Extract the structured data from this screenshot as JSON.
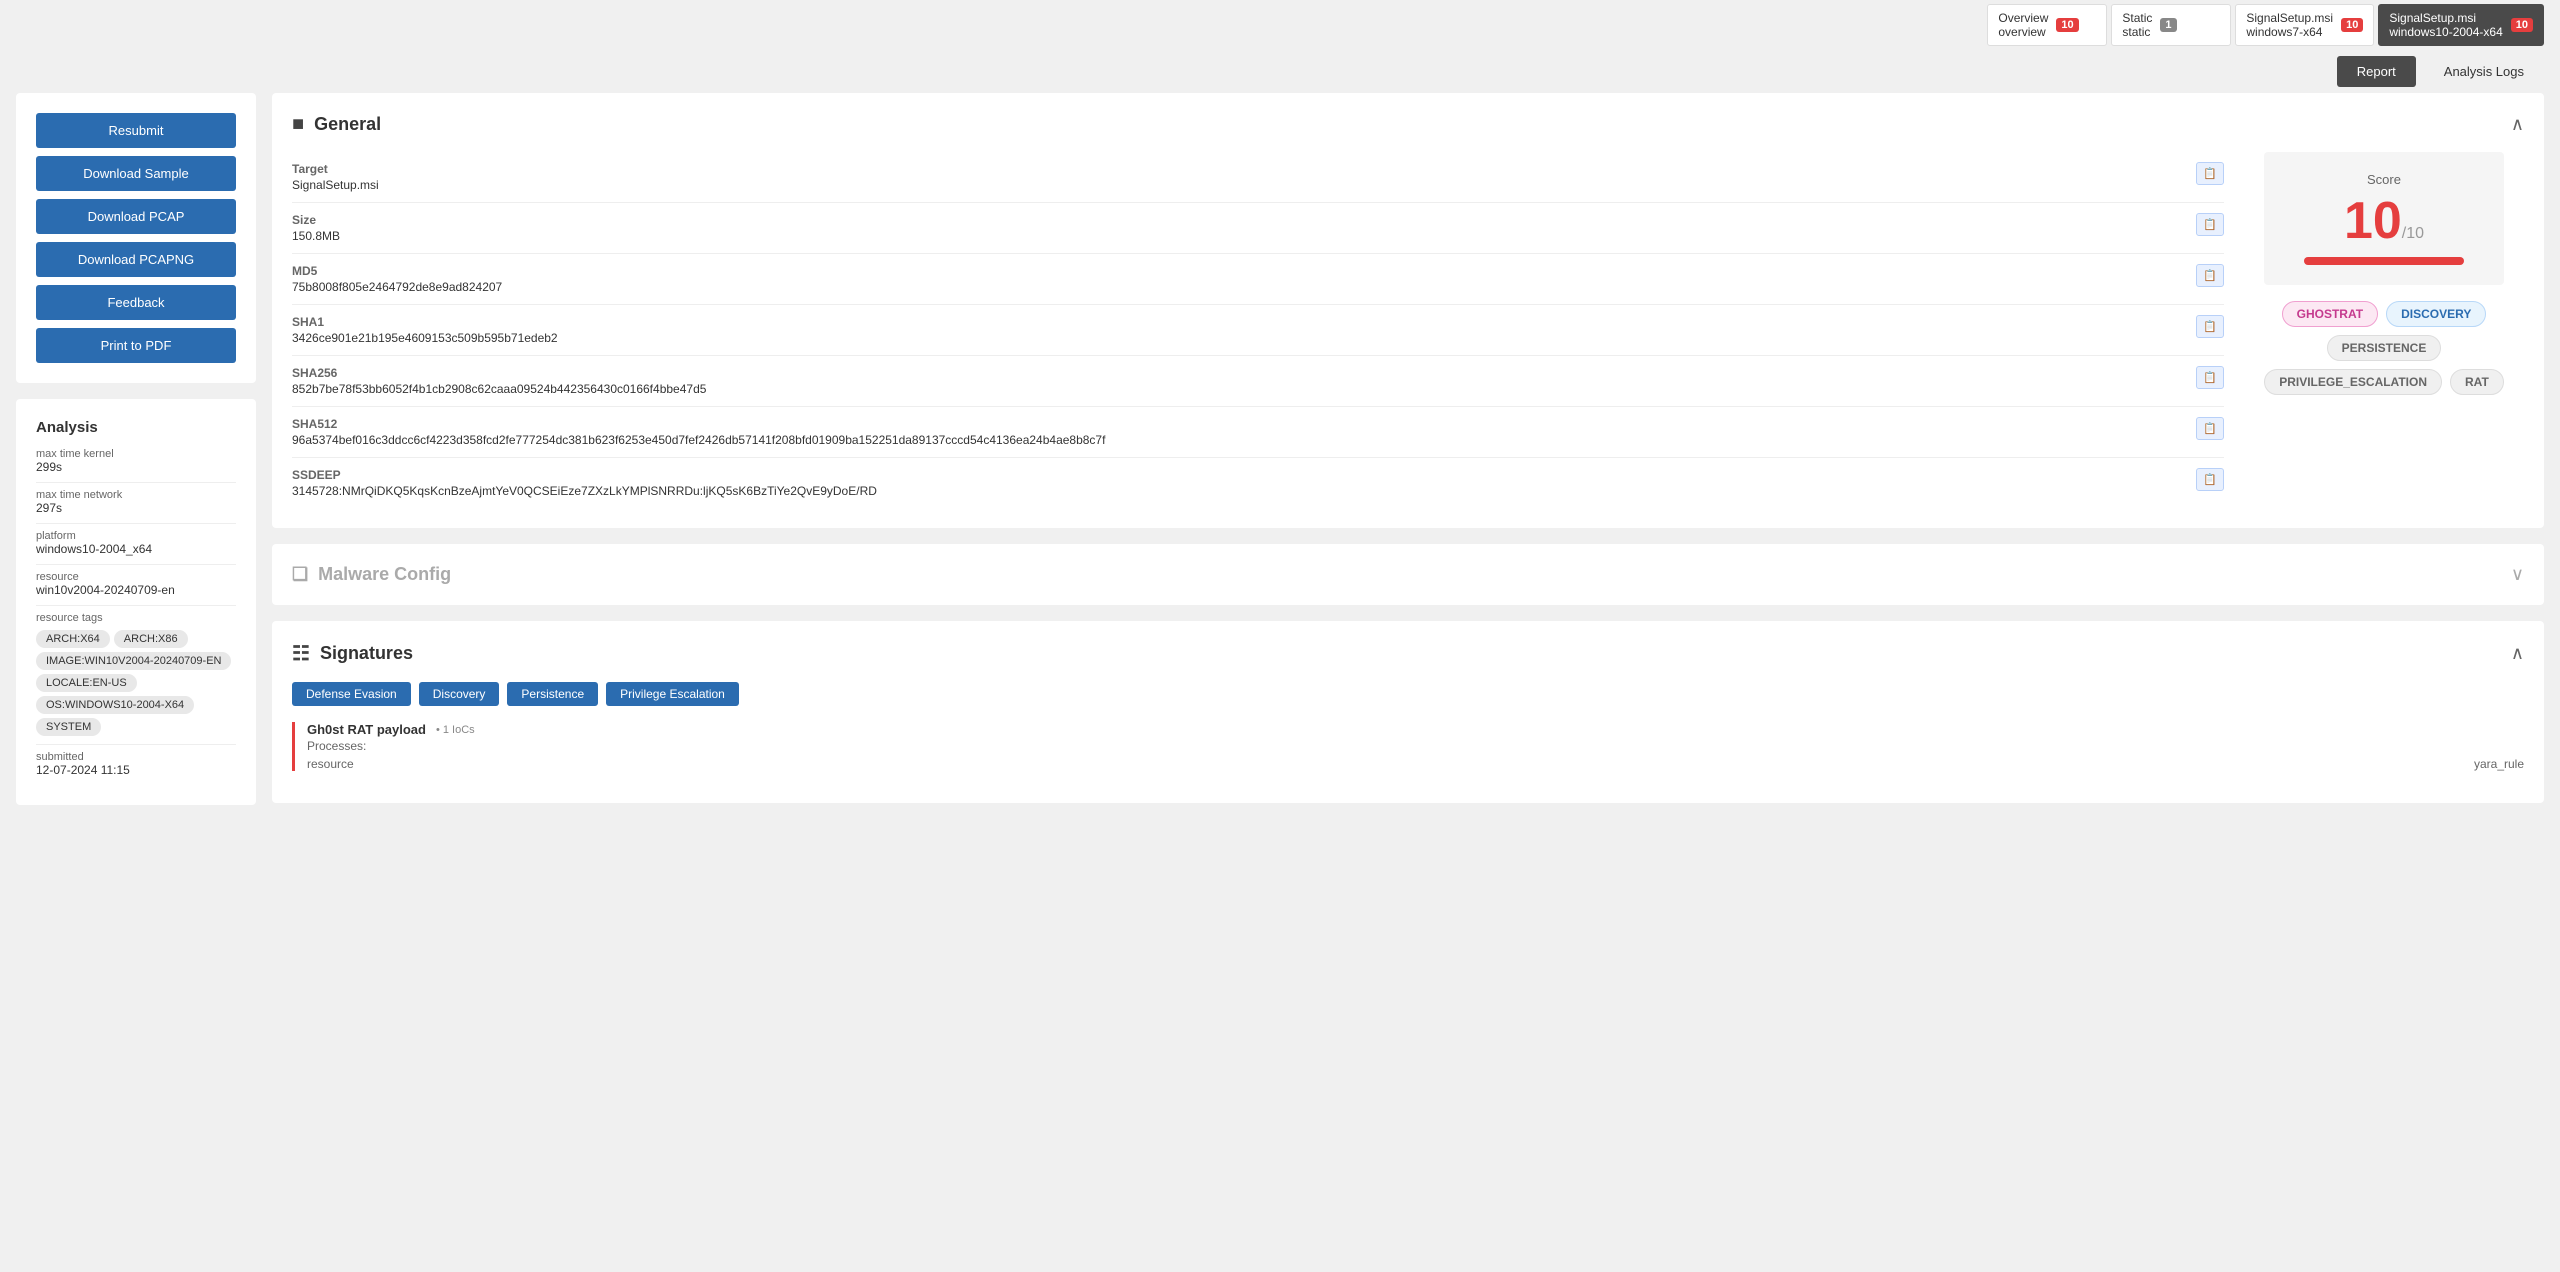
{
  "tabs": [
    {
      "id": "overview",
      "line1": "Overview",
      "line2": "overview",
      "badge": "10",
      "badge_color": "red",
      "active": false
    },
    {
      "id": "static",
      "line1": "Static",
      "line2": "static",
      "badge": "1",
      "badge_color": "gray",
      "active": false
    },
    {
      "id": "windows7",
      "line1": "SignalSetup.msi",
      "line2": "windows7-x64",
      "badge": "10",
      "badge_color": "red",
      "active": false
    },
    {
      "id": "windows10",
      "line1": "SignalSetup.msi",
      "line2": "windows10-2004-x64",
      "badge": "10",
      "badge_color": "red",
      "active": true
    }
  ],
  "actions": {
    "report": "Report",
    "analysis_logs": "Analysis Logs"
  },
  "sidebar": {
    "buttons": [
      "Resubmit",
      "Download Sample",
      "Download PCAP",
      "Download PCAPNG",
      "Feedback",
      "Print to PDF"
    ],
    "analysis": {
      "title": "Analysis",
      "fields": [
        {
          "label": "max time kernel",
          "value": "299s"
        },
        {
          "label": "max time network",
          "value": "297s"
        },
        {
          "label": "platform",
          "value": "windows10-2004_x64"
        },
        {
          "label": "resource",
          "value": "win10v2004-20240709-en"
        },
        {
          "label": "resource tags",
          "value": ""
        }
      ],
      "tags": [
        "ARCH:X64",
        "ARCH:X86",
        "IMAGE:WIN10V2004-20240709-EN",
        "LOCALE:EN-US",
        "OS:WINDOWS10-2004-X64",
        "SYSTEM"
      ],
      "submitted_label": "submitted",
      "submitted_value": "12-07-2024 11:15"
    }
  },
  "general": {
    "title": "General",
    "fields": [
      {
        "label": "Target",
        "value": "SignalSetup.msi"
      },
      {
        "label": "Size",
        "value": "150.8MB"
      },
      {
        "label": "MD5",
        "value": "75b8008f805e2464792de8e9ad824207"
      },
      {
        "label": "SHA1",
        "value": "3426ce901e21b195e4609153c509b595b71edeb2"
      },
      {
        "label": "SHA256",
        "value": "852b7be78f53bb6052f4b1cb2908c62caaa09524b442356430c0166f4bbe47d5"
      },
      {
        "label": "SHA512",
        "value": "96a5374bef016c3ddcc6cf4223d358fcd2fe777254dc381b623f6253e450d7fef2426db57141f208bfd01909ba152251da89137cccd54c4136ea24b4ae8b8c7f"
      },
      {
        "label": "SSDEEP",
        "value": "3145728:NMrQiDKQ5KqsKcnBzeAjmtYeV0QCSEiEze7ZXzLkYMPlSNRRDu:ljKQ5sK6BzTiYe2QvE9yDoE/RD"
      }
    ],
    "score": {
      "label": "Score",
      "value": "10",
      "max": "/10"
    },
    "threat_tags": [
      {
        "label": "GHOSTRAT",
        "style": "pink"
      },
      {
        "label": "DISCOVERY",
        "style": "blue"
      },
      {
        "label": "PERSISTENCE",
        "style": "gray-tag"
      },
      {
        "label": "PRIVILEGE_ESCALATION",
        "style": "gray-tag"
      },
      {
        "label": "RAT",
        "style": "gray-tag"
      }
    ]
  },
  "malware_config": {
    "title": "Malware Config"
  },
  "signatures": {
    "title": "Signatures",
    "filters": [
      "Defense Evasion",
      "Discovery",
      "Persistence",
      "Privilege Escalation"
    ],
    "items": [
      {
        "title": "Gh0st RAT payload",
        "iocs": "1 IoCs",
        "subtitle": "Processes:",
        "detail": "resource",
        "meta": "yara_rule"
      }
    ]
  }
}
